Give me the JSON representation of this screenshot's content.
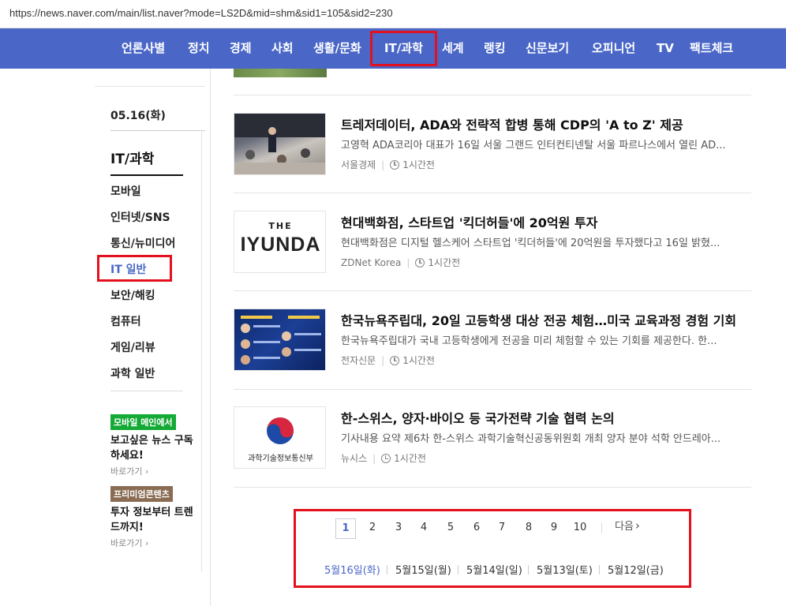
{
  "browser": {
    "url": "https://news.naver.com/main/list.naver?mode=LS2D&mid=shm&sid1=105&sid2=230"
  },
  "nav": {
    "items": [
      "언론사별",
      "정치",
      "경제",
      "사회",
      "생활/문화",
      "IT/과학",
      "세계",
      "랭킹",
      "신문보기",
      "오피니언",
      "TV",
      "팩트체크"
    ],
    "active_index": 5,
    "bg_color": "#4a67c8"
  },
  "sidebar": {
    "date": "05.16(화)",
    "heading": "IT/과학",
    "items": [
      "모바일",
      "인터넷/SNS",
      "통신/뉴미디어",
      "IT 일반",
      "보안/해킹",
      "컴퓨터",
      "게임/리뷰",
      "과학 일반"
    ],
    "active_index": 3,
    "promos": [
      {
        "badge": "모바일 메인에서",
        "title": "보고싶은 뉴스 구독하세요!",
        "link": "바로가기"
      },
      {
        "badge": "프리미엄콘텐츠",
        "title": "투자 정보부터 트렌드까지!",
        "link": "바로가기"
      }
    ]
  },
  "articles": [
    {
      "title": "트레저데이터, ADA와 전략적 합병 통해 CDP의 'A to Z' 제공",
      "desc": "고영혁 ADA코리아 대표가 16일 서울 그랜드 인터컨티넨탈 서울 파르나스에서 열린 AD...",
      "source": "서울경제",
      "time": "1시간전",
      "thumb": "conference-photo"
    },
    {
      "title": "현대백화점, 스타트업 '킥더허들'에 20억원 투자",
      "desc": "현대백화점은 디지털 헬스케어 스타트업 '킥더허들'에 20억원을 투자했다고 16일 밝혔...",
      "source": "ZDNet Korea",
      "time": "1시간전",
      "thumb": "hyundai-logo",
      "thumb_text": "IYUNDA",
      "thumb_top": "THE"
    },
    {
      "title": "한국뉴욕주립대, 20일 고등학생 대상 전공 체험…미국 교육과정 경험 기회",
      "desc": "한국뉴욕주립대가 국내 고등학생에게 전공을 미리 체험할 수 있는 기회를 제공한다. 한...",
      "source": "전자신문",
      "time": "1시간전",
      "thumb": "poster"
    },
    {
      "title": "한-스위스, 양자·바이오 등 국가전략 기술 협력 논의",
      "desc": "기사내용 요약 제6차 한-스위스 과학기술혁신공동위원회 개최 양자 분야 석학 안드레아...",
      "source": "뉴시스",
      "time": "1시간전",
      "thumb": "ministry-logo",
      "thumb_text": "과학기술정보통신부"
    }
  ],
  "pagination": {
    "pages": [
      "1",
      "2",
      "3",
      "4",
      "5",
      "6",
      "7",
      "8",
      "9",
      "10"
    ],
    "current": "1",
    "next_label": "다음",
    "dates": [
      "5월16일(화)",
      "5월15일(월)",
      "5월14일(일)",
      "5월13일(토)",
      "5월12일(금)"
    ],
    "current_date_index": 0
  }
}
